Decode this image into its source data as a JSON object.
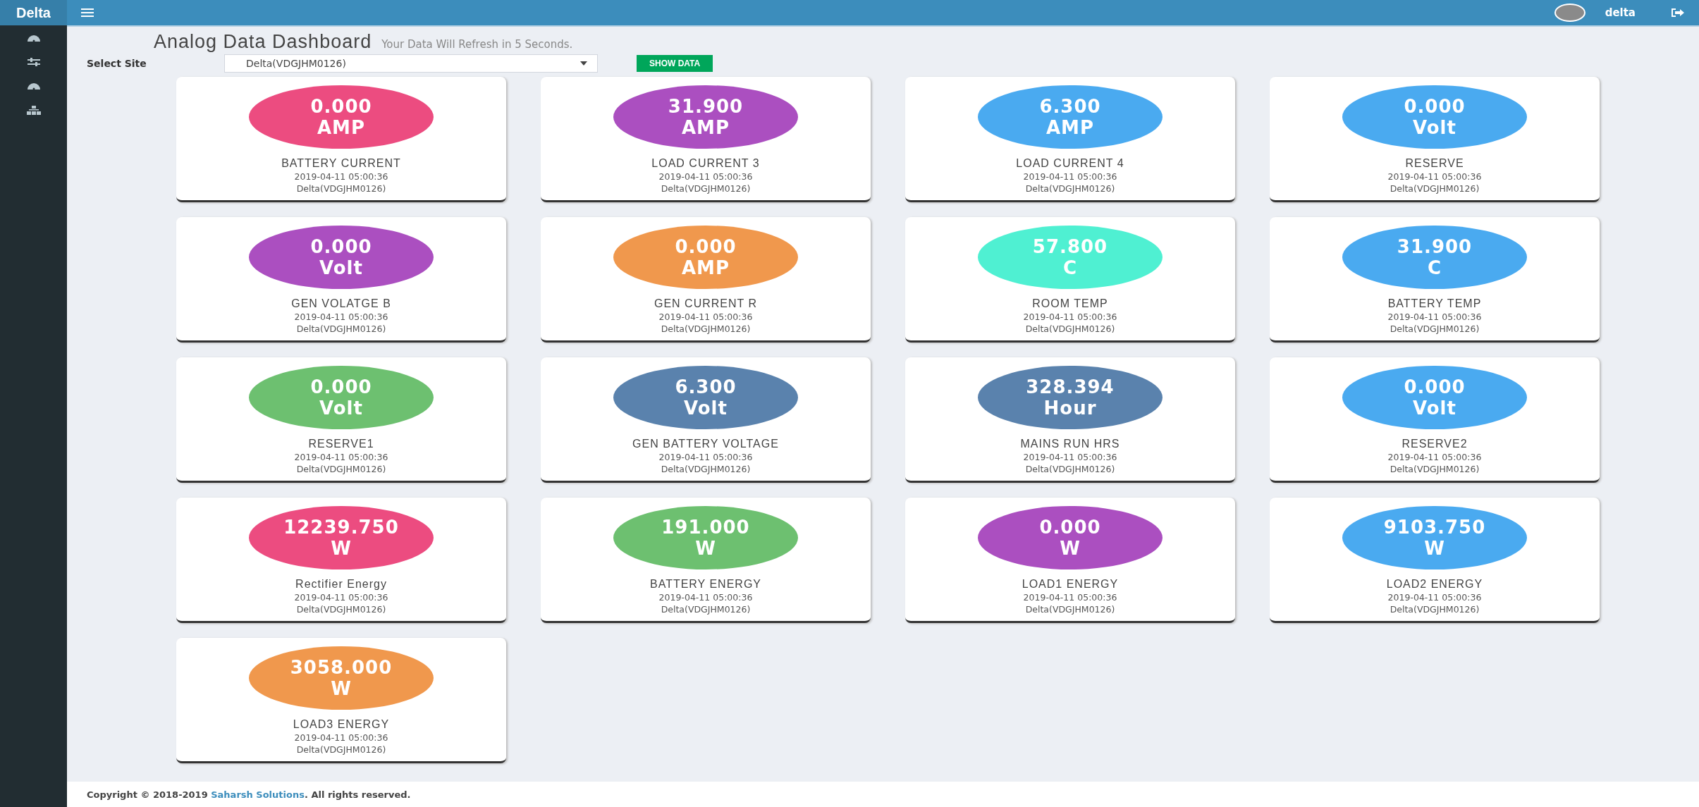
{
  "brand": "Delta",
  "user": {
    "name": "delta"
  },
  "header": {
    "title": "Analog Data Dashboard",
    "subtitle": "Your Data Will Refresh in 5 Seconds."
  },
  "site_select": {
    "label": "Select Site",
    "value": "Delta(VDGJHM0126)",
    "button": "SHOW DATA"
  },
  "cards": [
    {
      "value": "0.000",
      "unit": "AMP",
      "name": "BATTERY CURRENT",
      "time": "2019-04-11 05:00:36",
      "site": "Delta(VDGJHM0126)",
      "color": "#ec4c80"
    },
    {
      "value": "31.900",
      "unit": "AMP",
      "name": "LOAD CURRENT 3",
      "time": "2019-04-11 05:00:36",
      "site": "Delta(VDGJHM0126)",
      "color": "#ab4fc0"
    },
    {
      "value": "6.300",
      "unit": "AMP",
      "name": "LOAD CURRENT 4",
      "time": "2019-04-11 05:00:36",
      "site": "Delta(VDGJHM0126)",
      "color": "#4aaaf0"
    },
    {
      "value": "0.000",
      "unit": "Volt",
      "name": "RESERVE",
      "time": "2019-04-11 05:00:36",
      "site": "Delta(VDGJHM0126)",
      "color": "#4aaaf0"
    },
    {
      "value": "0.000",
      "unit": "Volt",
      "name": "GEN VOLATGE B",
      "time": "2019-04-11 05:00:36",
      "site": "Delta(VDGJHM0126)",
      "color": "#ab4fc0"
    },
    {
      "value": "0.000",
      "unit": "AMP",
      "name": "GEN CURRENT R",
      "time": "2019-04-11 05:00:36",
      "site": "Delta(VDGJHM0126)",
      "color": "#f0984d"
    },
    {
      "value": "57.800",
      "unit": "C",
      "name": "ROOM TEMP",
      "time": "2019-04-11 05:00:36",
      "site": "Delta(VDGJHM0126)",
      "color": "#4ff0d2"
    },
    {
      "value": "31.900",
      "unit": "C",
      "name": "BATTERY TEMP",
      "time": "2019-04-11 05:00:36",
      "site": "Delta(VDGJHM0126)",
      "color": "#4aaaf0"
    },
    {
      "value": "0.000",
      "unit": "Volt",
      "name": "RESERVE1",
      "time": "2019-04-11 05:00:36",
      "site": "Delta(VDGJHM0126)",
      "color": "#6dc070"
    },
    {
      "value": "6.300",
      "unit": "Volt",
      "name": "GEN BATTERY VOLTAGE",
      "time": "2019-04-11 05:00:36",
      "site": "Delta(VDGJHM0126)",
      "color": "#5a82ad"
    },
    {
      "value": "328.394",
      "unit": "Hour",
      "name": "MAINS RUN HRS",
      "time": "2019-04-11 05:00:36",
      "site": "Delta(VDGJHM0126)",
      "color": "#5a82ad"
    },
    {
      "value": "0.000",
      "unit": "Volt",
      "name": "RESERVE2",
      "time": "2019-04-11 05:00:36",
      "site": "Delta(VDGJHM0126)",
      "color": "#4aaaf0"
    },
    {
      "value": "12239.750",
      "unit": "W",
      "name": "Rectifier Energy",
      "time": "2019-04-11 05:00:36",
      "site": "Delta(VDGJHM0126)",
      "color": "#ec4c80"
    },
    {
      "value": "191.000",
      "unit": "W",
      "name": "BATTERY ENERGY",
      "time": "2019-04-11 05:00:36",
      "site": "Delta(VDGJHM0126)",
      "color": "#6dc070"
    },
    {
      "value": "0.000",
      "unit": "W",
      "name": "LOAD1 ENERGY",
      "time": "2019-04-11 05:00:36",
      "site": "Delta(VDGJHM0126)",
      "color": "#ab4fc0"
    },
    {
      "value": "9103.750",
      "unit": "W",
      "name": "LOAD2 ENERGY",
      "time": "2019-04-11 05:00:36",
      "site": "Delta(VDGJHM0126)",
      "color": "#4aaaf0"
    },
    {
      "value": "3058.000",
      "unit": "W",
      "name": "LOAD3 ENERGY",
      "time": "2019-04-11 05:00:36",
      "site": "Delta(VDGJHM0126)",
      "color": "#f0984d"
    }
  ],
  "footer": {
    "before": "Copyright © 2018-2019 ",
    "link": "Saharsh Solutions",
    "after": ". All rights reserved."
  }
}
